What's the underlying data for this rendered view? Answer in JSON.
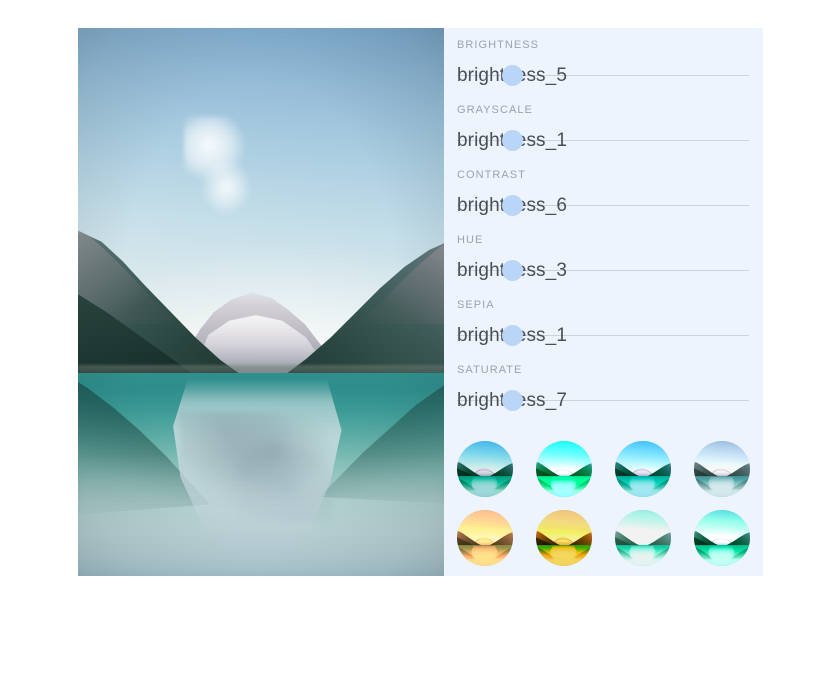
{
  "app": {
    "panel_bg": "#eef4fd",
    "thumb_color": "#b9d5f7",
    "track_color": "#cfd3d8",
    "label_color": "#9aa3ad",
    "value_color": "#4a4f55"
  },
  "preview": {
    "alt": "lake-louise-mountain-reflection-photo"
  },
  "controls": [
    {
      "label": "BRIGHTNESS",
      "value": "brightness_5",
      "thumb_percent": 19
    },
    {
      "label": "GRAYSCALE",
      "value": "brightness_1",
      "thumb_percent": 19
    },
    {
      "label": "CONTRAST",
      "value": "brightness_6",
      "thumb_percent": 19
    },
    {
      "label": "HUE",
      "value": "brightness_3",
      "thumb_percent": 19
    },
    {
      "label": "SEPIA",
      "value": "brightness_1",
      "thumb_percent": 19
    },
    {
      "label": "SATURATE",
      "value": "brightness_7",
      "thumb_percent": 19
    }
  ],
  "presets": {
    "rows": [
      [
        {
          "name": "preset-1"
        },
        {
          "name": "preset-2"
        },
        {
          "name": "preset-3"
        },
        {
          "name": "preset-4"
        }
      ],
      [
        {
          "name": "preset-5"
        },
        {
          "name": "preset-6"
        },
        {
          "name": "preset-7"
        },
        {
          "name": "preset-8"
        }
      ]
    ]
  }
}
